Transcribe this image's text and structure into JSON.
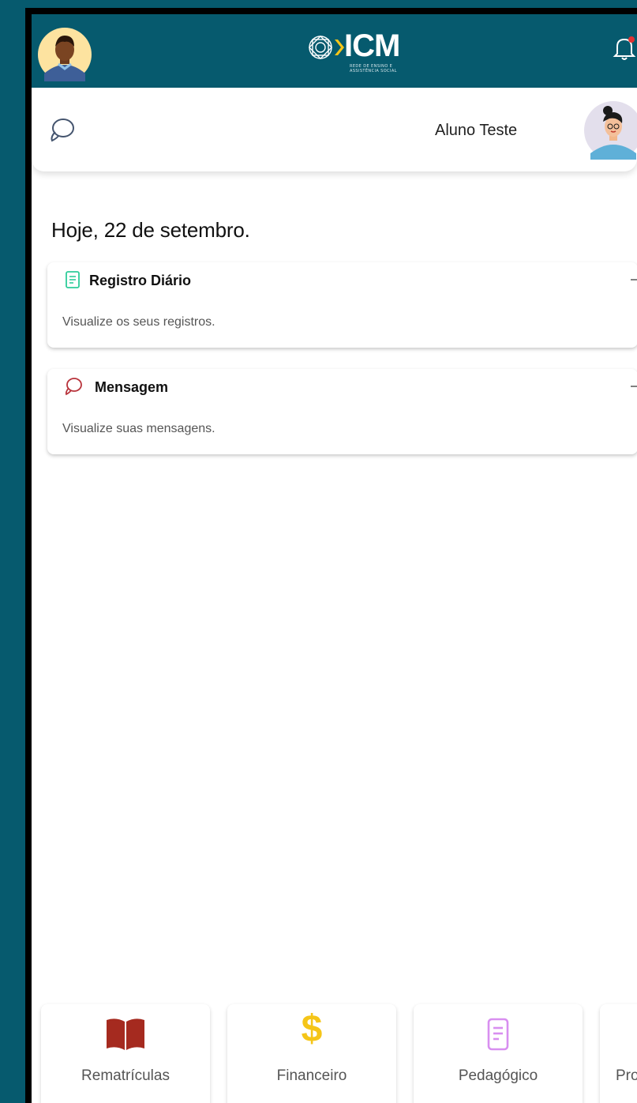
{
  "header": {
    "logo_text": "ICM",
    "logo_subtitle": "REDE DE ENSINO E ASSISTÊNCIA SOCIAL"
  },
  "user": {
    "name": "Aluno Teste"
  },
  "main": {
    "date_heading": "Hoje, 22 de setembro.",
    "cards": [
      {
        "title": "Registro Diário",
        "description": "Visualize os seus registros.",
        "icon": "document-icon",
        "icon_color": "#2ecc9a"
      },
      {
        "title": "Mensagem",
        "description": "Visualize suas mensagens.",
        "icon": "chat-icon",
        "icon_color": "#b8333b"
      }
    ]
  },
  "bottom_nav": [
    {
      "label": "Rematrículas",
      "icon": "book-icon",
      "icon_color": "#a52a1f"
    },
    {
      "label": "Financeiro",
      "icon": "dollar-icon",
      "icon_color": "#f5c518"
    },
    {
      "label": "Pedagógico",
      "icon": "document-icon",
      "icon_color": "#d88ff0"
    },
    {
      "label": "Pro",
      "icon": "",
      "icon_color": ""
    }
  ],
  "colors": {
    "brand": "#065a6e",
    "accent": "#f5c518",
    "notification_dot": "#e03131"
  }
}
